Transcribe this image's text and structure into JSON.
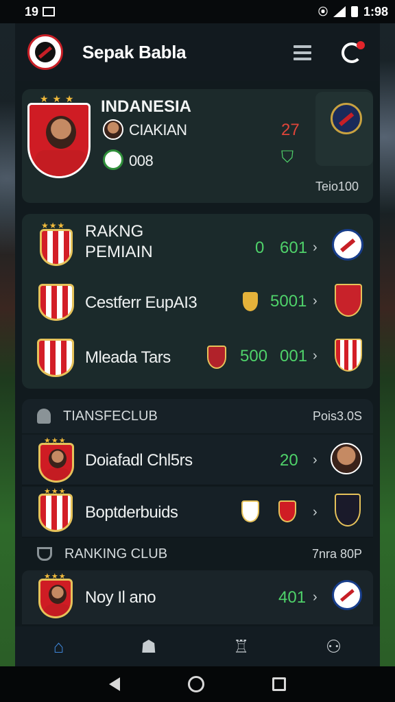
{
  "status": {
    "left": "19",
    "time": "1:98"
  },
  "app": {
    "title": "Sepak Babla"
  },
  "featured": {
    "title": "INDANESIA",
    "stat1_label": "CIAKIAN",
    "stat1_value": "27",
    "stat2_label": "008",
    "footer": "Teio100"
  },
  "ranking_pemain": {
    "title_line1": "RAKNG",
    "title_line2": "PEMIAIN",
    "val_a": "0",
    "val_b": "601",
    "rows": [
      {
        "label": "Cestferr EupAI3",
        "value": "5001"
      },
      {
        "label": "Mleada Tars",
        "value_a": "500",
        "value_b": "001"
      }
    ]
  },
  "transfer": {
    "title": "TIANSFECLUB",
    "right": "Pois3.0S",
    "rows": [
      {
        "label": "Doiafadl Chl5rs",
        "value": "20"
      },
      {
        "label": "Boptderbuids"
      }
    ]
  },
  "ranking_club": {
    "title": "RANKING CLUB",
    "right": "7nra 80P",
    "rows": [
      {
        "label": "Noy Il ano",
        "value": "401"
      }
    ]
  },
  "chevron": "›",
  "colors": {
    "accent_green": "#4fd26a",
    "accent_red": "#e0453a",
    "tab_active": "#3f86d8"
  }
}
